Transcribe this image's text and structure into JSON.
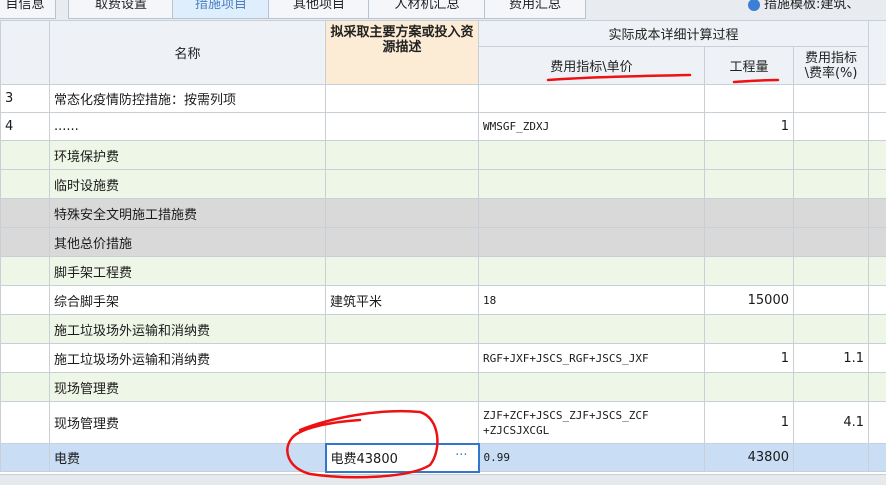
{
  "tabs": [
    "目信息",
    "取费设置",
    "措施项目",
    "其他项目",
    "人材机汇总",
    "费用汇总"
  ],
  "active_tab_index": 2,
  "template_selector": "措施模板:建筑、",
  "headers": {
    "name": "名称",
    "plan_desc": "拟采取主要方案或投入资源描述",
    "calc_group": "实际成本详细计算过程",
    "fee_index": "费用指标\\单价",
    "quantity": "工程量",
    "fee_rate": "费用指标\\费率(%)"
  },
  "rows": [
    {
      "no": "3",
      "name": "常态化疫情防控措施：按需列项",
      "desc": "",
      "index": "",
      "qty": "",
      "rate": ""
    },
    {
      "no": "4",
      "name": "......",
      "desc": "",
      "index": "WMSGF_ZDXJ",
      "qty": "1",
      "rate": ""
    },
    {
      "no": "",
      "name": "环境保护费",
      "desc": "",
      "index": "",
      "qty": "",
      "rate": ""
    },
    {
      "no": "",
      "name": "临时设施费",
      "desc": "",
      "index": "",
      "qty": "",
      "rate": ""
    },
    {
      "no": "",
      "name": "特殊安全文明施工措施费",
      "desc": "",
      "index": "",
      "qty": "",
      "rate": ""
    },
    {
      "no": "",
      "name": "其他总价措施",
      "desc": "",
      "index": "",
      "qty": "",
      "rate": ""
    },
    {
      "no": "",
      "name": "脚手架工程费",
      "desc": "",
      "index": "",
      "qty": "",
      "rate": ""
    },
    {
      "no": "",
      "name": "综合脚手架",
      "desc": "建筑平米",
      "index": "18",
      "qty": "15000",
      "rate": ""
    },
    {
      "no": "",
      "name": "施工垃圾场外运输和消纳费",
      "desc": "",
      "index": "",
      "qty": "",
      "rate": ""
    },
    {
      "no": "",
      "name": "施工垃圾场外运输和消纳费",
      "desc": "",
      "index": "RGF+JXF+JSCS_RGF+JSCS_JXF",
      "qty": "1",
      "rate": "1.1"
    },
    {
      "no": "",
      "name": "现场管理费",
      "desc": "",
      "index": "",
      "qty": "",
      "rate": ""
    },
    {
      "no": "",
      "name": "现场管理费",
      "desc": "",
      "index": "ZJF+ZCF+JSCS_ZJF+JSCS_ZCF +ZJCSJXCGL",
      "qty": "1",
      "rate": "4.1"
    },
    {
      "no": "",
      "name": "电费",
      "desc": "电费43800",
      "index": "0.99",
      "qty": "43800",
      "rate": ""
    }
  ],
  "ellipsis_button": "···",
  "colors": {
    "annotation_red": "#ee1111",
    "selection_blue": "#3377cc",
    "group_green": "#eef6e7",
    "group_gray": "#d9d9d9",
    "header_orange": "#fcecd5"
  }
}
